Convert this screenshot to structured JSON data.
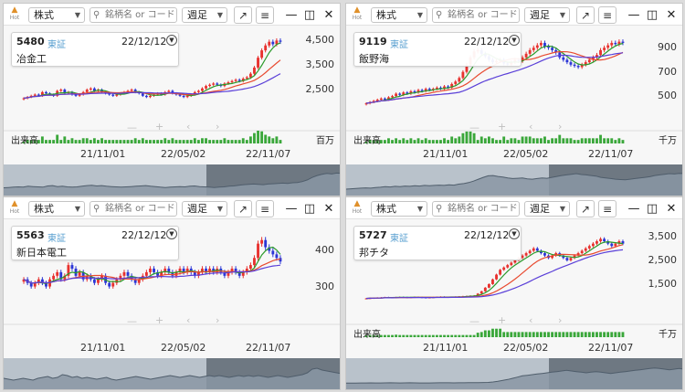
{
  "toolbar": {
    "logo_text": "Hot",
    "market_type": "株式",
    "search_placeholder": "銘柄名 or コード",
    "period": "週足"
  },
  "icons": {
    "logo": "flame-icon",
    "search": "search-icon",
    "popout": "popout-arrow-icon",
    "menu": "menu-lines-icon",
    "minimize": "minimize-icon",
    "maximize": "maximize-icon",
    "close": "close-icon"
  },
  "colors": {
    "up_candle": "#e8312e",
    "down_candle": "#2b35d6",
    "ma_short": "#2a9a2a",
    "ma_mid": "#e84a30",
    "ma_long": "#5a3fd8",
    "volume": "#3aa73a"
  },
  "x_ticks": [
    "21/11/01",
    "22/05/02",
    "22/11/07"
  ],
  "panels": [
    {
      "code": "5480",
      "market": "東証",
      "date": "22/12/12",
      "name": "冶金工",
      "y_ticks": [
        "4,500",
        "3,500",
        "2,500"
      ],
      "volume_label": "出来高",
      "volume_unit": "百万",
      "chart_data": {
        "type": "candlestick",
        "x_ticks": [
          "21/11/01",
          "22/05/02",
          "22/11/07"
        ],
        "ylim": [
          1500,
          4700
        ],
        "close": [
          2150,
          2200,
          2250,
          2300,
          2250,
          2400,
          2350,
          2300,
          2250,
          2450,
          2500,
          2350,
          2400,
          2300,
          2250,
          2300,
          2400,
          2500,
          2550,
          2450,
          2500,
          2400,
          2350,
          2300,
          2250,
          2300,
          2350,
          2400,
          2450,
          2500,
          2400,
          2350,
          2250,
          2200,
          2250,
          2300,
          2350,
          2300,
          2400,
          2450,
          2350,
          2300,
          2250,
          2200,
          2250,
          2300,
          2400,
          2450,
          2550,
          2650,
          2700,
          2750,
          2700,
          2650,
          2750,
          2800,
          2850,
          2900,
          2850,
          2950,
          3000,
          3150,
          3400,
          3800,
          4100,
          4300,
          4450,
          4350,
          4500,
          4450
        ]
      }
    },
    {
      "code": "9119",
      "market": "東証",
      "date": "22/12/12",
      "name": "飯野海",
      "y_ticks": [
        "900",
        "700",
        "500"
      ],
      "volume_label": "出来高",
      "volume_unit": "千万",
      "chart_data": {
        "type": "candlestick",
        "x_ticks": [
          "21/11/01",
          "22/05/02",
          "22/11/07"
        ],
        "ylim": [
          350,
          1000
        ],
        "close": [
          440,
          450,
          460,
          470,
          480,
          470,
          490,
          500,
          520,
          510,
          530,
          520,
          540,
          530,
          550,
          540,
          560,
          550,
          560,
          570,
          560,
          580,
          570,
          600,
          620,
          650,
          700,
          760,
          820,
          870,
          880,
          850,
          830,
          800,
          780,
          790,
          800,
          770,
          760,
          780,
          800,
          790,
          820,
          850,
          880,
          900,
          920,
          940,
          910,
          900,
          880,
          860,
          820,
          800,
          780,
          760,
          750,
          740,
          760,
          780,
          800,
          820,
          840,
          880,
          900,
          920,
          940,
          930,
          950,
          940
        ]
      }
    },
    {
      "code": "5563",
      "market": "東証",
      "date": "22/12/12",
      "name": "新日本電工",
      "y_ticks": [
        "400",
        "300"
      ],
      "volume_label": "",
      "volume_unit": "",
      "chart_data": {
        "type": "candlestick",
        "x_ticks": [
          "21/11/01",
          "22/05/02",
          "22/11/07"
        ],
        "ylim": [
          240,
          460
        ],
        "close": [
          320,
          310,
          300,
          310,
          320,
          310,
          300,
          320,
          330,
          340,
          320,
          330,
          360,
          350,
          330,
          340,
          320,
          330,
          320,
          310,
          320,
          330,
          310,
          300,
          310,
          320,
          330,
          340,
          330,
          320,
          310,
          320,
          330,
          340,
          350,
          340,
          330,
          340,
          350,
          340,
          330,
          340,
          350,
          340,
          350,
          340,
          330,
          340,
          350,
          340,
          350,
          340,
          350,
          340,
          330,
          340,
          350,
          340,
          330,
          340,
          350,
          360,
          380,
          420,
          430,
          410,
          400,
          390,
          380,
          370
        ]
      }
    },
    {
      "code": "5727",
      "market": "東証",
      "date": "22/12/12",
      "name": "邦チタ",
      "y_ticks": [
        "3,500",
        "2,500",
        "1,500"
      ],
      "volume_label": "出来高",
      "volume_unit": "千万",
      "chart_data": {
        "type": "candlestick",
        "x_ticks": [
          "21/11/01",
          "22/05/02",
          "22/11/07"
        ],
        "ylim": [
          500,
          3800
        ],
        "close": [
          900,
          910,
          920,
          930,
          940,
          950,
          940,
          930,
          950,
          960,
          950,
          940,
          950,
          960,
          950,
          940,
          930,
          940,
          950,
          960,
          970,
          960,
          950,
          960,
          970,
          980,
          990,
          1000,
          1010,
          1020,
          1100,
          1200,
          1350,
          1500,
          1700,
          1900,
          2100,
          2200,
          2300,
          2400,
          2500,
          2600,
          2700,
          2800,
          2900,
          3000,
          2900,
          2800,
          2700,
          2600,
          2700,
          2800,
          2700,
          2600,
          2500,
          2600,
          2700,
          2800,
          2900,
          3000,
          3100,
          3200,
          3300,
          3400,
          3300,
          3200,
          3100,
          3200,
          3300,
          3200
        ]
      }
    }
  ]
}
